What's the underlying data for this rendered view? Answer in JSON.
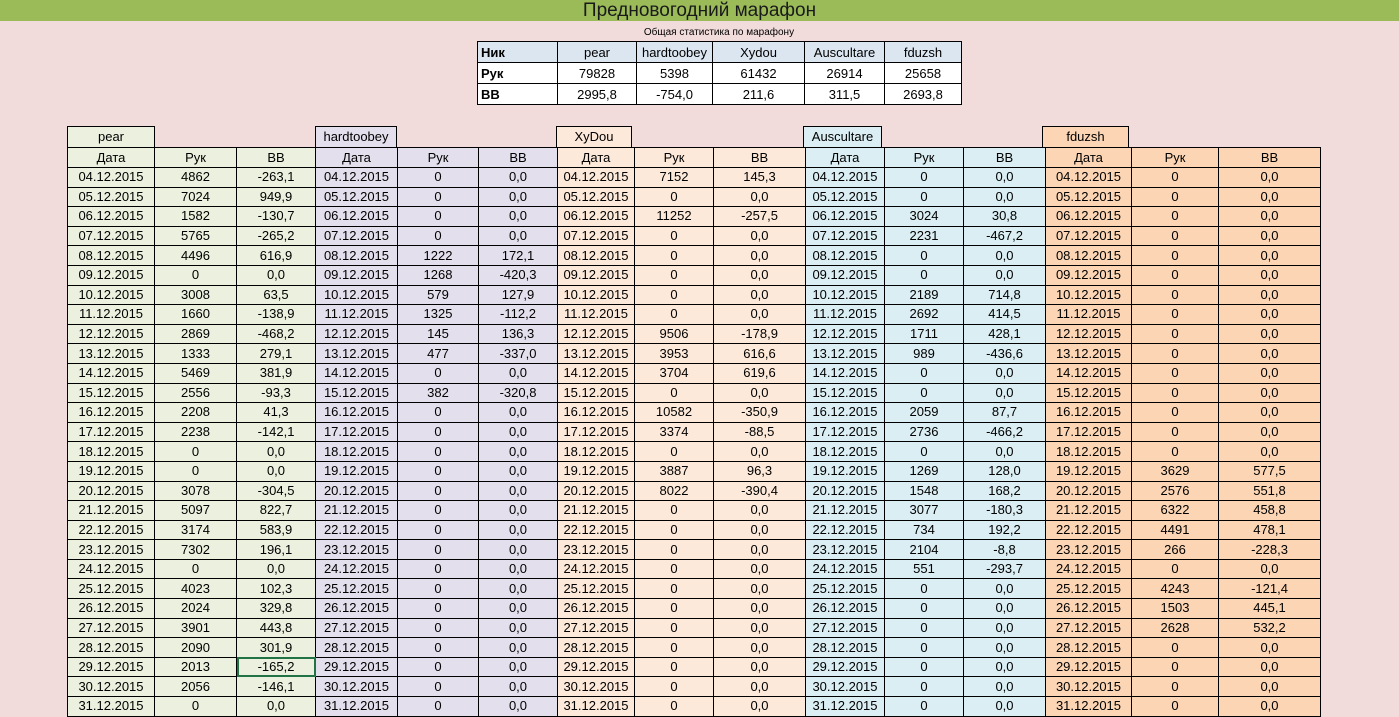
{
  "title": "Предновогодний марафон",
  "summary": {
    "caption": "Общая статистика по марафону",
    "nick_label": "Ник",
    "hands_label": "Рук",
    "bb_label": "BB",
    "players": [
      {
        "name": "pear",
        "hands": "79828",
        "bb": "2995,8"
      },
      {
        "name": "hardtoobey",
        "hands": "5398",
        "bb": "-754,0"
      },
      {
        "name": "Xydou",
        "hands": "61432",
        "bb": "211,6"
      },
      {
        "name": "Auscultare",
        "hands": "26914",
        "bb": "311,5"
      },
      {
        "name": "fduzsh",
        "hands": "25658",
        "bb": "2693,8"
      }
    ]
  },
  "players": [
    "pear",
    "hardtoobey",
    "XyDou",
    "Auscultare",
    "fduzsh"
  ],
  "columns": {
    "date": "Дата",
    "hands": "Рук",
    "bb": "BB"
  },
  "dates": [
    "04.12.2015",
    "05.12.2015",
    "06.12.2015",
    "07.12.2015",
    "08.12.2015",
    "09.12.2015",
    "10.12.2015",
    "11.12.2015",
    "12.12.2015",
    "13.12.2015",
    "14.12.2015",
    "15.12.2015",
    "16.12.2015",
    "17.12.2015",
    "18.12.2015",
    "19.12.2015",
    "20.12.2015",
    "21.12.2015",
    "22.12.2015",
    "23.12.2015",
    "24.12.2015",
    "25.12.2015",
    "26.12.2015",
    "27.12.2015",
    "28.12.2015",
    "29.12.2015",
    "30.12.2015",
    "31.12.2015"
  ],
  "stats": {
    "pear": [
      [
        "4862",
        "-263,1"
      ],
      [
        "7024",
        "949,9"
      ],
      [
        "1582",
        "-130,7"
      ],
      [
        "5765",
        "-265,2"
      ],
      [
        "4496",
        "616,9"
      ],
      [
        "0",
        "0,0"
      ],
      [
        "3008",
        "63,5"
      ],
      [
        "1660",
        "-138,9"
      ],
      [
        "2869",
        "-468,2"
      ],
      [
        "1333",
        "279,1"
      ],
      [
        "5469",
        "381,9"
      ],
      [
        "2556",
        "-93,3"
      ],
      [
        "2208",
        "41,3"
      ],
      [
        "2238",
        "-142,1"
      ],
      [
        "0",
        "0,0"
      ],
      [
        "0",
        "0,0"
      ],
      [
        "3078",
        "-304,5"
      ],
      [
        "5097",
        "822,7"
      ],
      [
        "3174",
        "583,9"
      ],
      [
        "7302",
        "196,1"
      ],
      [
        "0",
        "0,0"
      ],
      [
        "4023",
        "102,3"
      ],
      [
        "2024",
        "329,8"
      ],
      [
        "3901",
        "443,8"
      ],
      [
        "2090",
        "301,9"
      ],
      [
        "2013",
        "-165,2"
      ],
      [
        "2056",
        "-146,1"
      ],
      [
        "0",
        "0,0"
      ]
    ],
    "hardtoobey": [
      [
        "0",
        "0,0"
      ],
      [
        "0",
        "0,0"
      ],
      [
        "0",
        "0,0"
      ],
      [
        "0",
        "0,0"
      ],
      [
        "1222",
        "172,1"
      ],
      [
        "1268",
        "-420,3"
      ],
      [
        "579",
        "127,9"
      ],
      [
        "1325",
        "-112,2"
      ],
      [
        "145",
        "136,3"
      ],
      [
        "477",
        "-337,0"
      ],
      [
        "0",
        "0,0"
      ],
      [
        "382",
        "-320,8"
      ],
      [
        "0",
        "0,0"
      ],
      [
        "0",
        "0,0"
      ],
      [
        "0",
        "0,0"
      ],
      [
        "0",
        "0,0"
      ],
      [
        "0",
        "0,0"
      ],
      [
        "0",
        "0,0"
      ],
      [
        "0",
        "0,0"
      ],
      [
        "0",
        "0,0"
      ],
      [
        "0",
        "0,0"
      ],
      [
        "0",
        "0,0"
      ],
      [
        "0",
        "0,0"
      ],
      [
        "0",
        "0,0"
      ],
      [
        "0",
        "0,0"
      ],
      [
        "0",
        "0,0"
      ],
      [
        "0",
        "0,0"
      ],
      [
        "0",
        "0,0"
      ]
    ],
    "XyDou": [
      [
        "7152",
        "145,3"
      ],
      [
        "0",
        "0,0"
      ],
      [
        "11252",
        "-257,5"
      ],
      [
        "0",
        "0,0"
      ],
      [
        "0",
        "0,0"
      ],
      [
        "0",
        "0,0"
      ],
      [
        "0",
        "0,0"
      ],
      [
        "0",
        "0,0"
      ],
      [
        "9506",
        "-178,9"
      ],
      [
        "3953",
        "616,6"
      ],
      [
        "3704",
        "619,6"
      ],
      [
        "0",
        "0,0"
      ],
      [
        "10582",
        "-350,9"
      ],
      [
        "3374",
        "-88,5"
      ],
      [
        "0",
        "0,0"
      ],
      [
        "3887",
        "96,3"
      ],
      [
        "8022",
        "-390,4"
      ],
      [
        "0",
        "0,0"
      ],
      [
        "0",
        "0,0"
      ],
      [
        "0",
        "0,0"
      ],
      [
        "0",
        "0,0"
      ],
      [
        "0",
        "0,0"
      ],
      [
        "0",
        "0,0"
      ],
      [
        "0",
        "0,0"
      ],
      [
        "0",
        "0,0"
      ],
      [
        "0",
        "0,0"
      ],
      [
        "0",
        "0,0"
      ],
      [
        "0",
        "0,0"
      ]
    ],
    "Auscultare": [
      [
        "0",
        "0,0"
      ],
      [
        "0",
        "0,0"
      ],
      [
        "3024",
        "30,8"
      ],
      [
        "2231",
        "-467,2"
      ],
      [
        "0",
        "0,0"
      ],
      [
        "0",
        "0,0"
      ],
      [
        "2189",
        "714,8"
      ],
      [
        "2692",
        "414,5"
      ],
      [
        "1711",
        "428,1"
      ],
      [
        "989",
        "-436,6"
      ],
      [
        "0",
        "0,0"
      ],
      [
        "0",
        "0,0"
      ],
      [
        "2059",
        "87,7"
      ],
      [
        "2736",
        "-466,2"
      ],
      [
        "0",
        "0,0"
      ],
      [
        "1269",
        "128,0"
      ],
      [
        "1548",
        "168,2"
      ],
      [
        "3077",
        "-180,3"
      ],
      [
        "734",
        "192,2"
      ],
      [
        "2104",
        "-8,8"
      ],
      [
        "551",
        "-293,7"
      ],
      [
        "0",
        "0,0"
      ],
      [
        "0",
        "0,0"
      ],
      [
        "0",
        "0,0"
      ],
      [
        "0",
        "0,0"
      ],
      [
        "0",
        "0,0"
      ],
      [
        "0",
        "0,0"
      ],
      [
        "0",
        "0,0"
      ]
    ],
    "fduzsh": [
      [
        "0",
        "0,0"
      ],
      [
        "0",
        "0,0"
      ],
      [
        "0",
        "0,0"
      ],
      [
        "0",
        "0,0"
      ],
      [
        "0",
        "0,0"
      ],
      [
        "0",
        "0,0"
      ],
      [
        "0",
        "0,0"
      ],
      [
        "0",
        "0,0"
      ],
      [
        "0",
        "0,0"
      ],
      [
        "0",
        "0,0"
      ],
      [
        "0",
        "0,0"
      ],
      [
        "0",
        "0,0"
      ],
      [
        "0",
        "0,0"
      ],
      [
        "0",
        "0,0"
      ],
      [
        "0",
        "0,0"
      ],
      [
        "3629",
        "577,5"
      ],
      [
        "2576",
        "551,8"
      ],
      [
        "6322",
        "458,8"
      ],
      [
        "4491",
        "478,1"
      ],
      [
        "266",
        "-228,3"
      ],
      [
        "0",
        "0,0"
      ],
      [
        "4243",
        "-121,4"
      ],
      [
        "1503",
        "445,1"
      ],
      [
        "2628",
        "532,2"
      ],
      [
        "0",
        "0,0"
      ],
      [
        "0",
        "0,0"
      ],
      [
        "0",
        "0,0"
      ],
      [
        "0",
        "0,0"
      ]
    ]
  },
  "selected_cell": {
    "player": "pear",
    "row": "29.12.2015",
    "column": "BB"
  },
  "colors": {
    "title_bar": "#9bbb59",
    "background": "#f2dcdb",
    "pear": "#ebf1de",
    "hardtoobey": "#e4dfec",
    "XyDou": "#fde9d9",
    "Auscultare": "#daeef3",
    "fduzsh": "#fcd5b4",
    "selection": "#217346"
  }
}
